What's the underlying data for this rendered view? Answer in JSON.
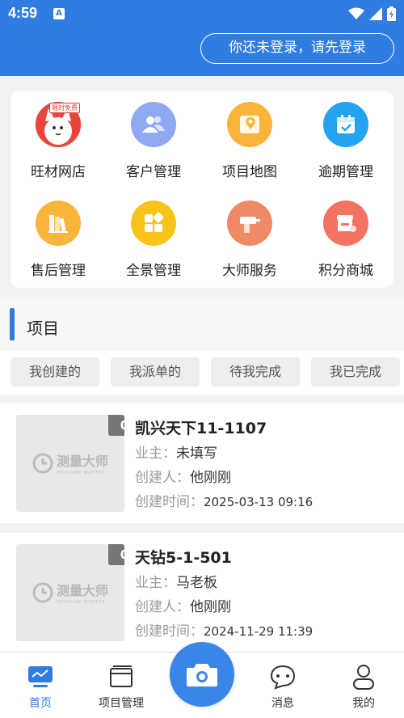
{
  "status": {
    "time": "4:59",
    "app_icon_letter": "A"
  },
  "header": {
    "login_prompt": "你还未登录，请先登录"
  },
  "grid": {
    "items": [
      {
        "label": "旺材网店",
        "icon": "store-mascot-icon",
        "color": "#e8463a",
        "promo_tag": "限时免费"
      },
      {
        "label": "客户管理",
        "icon": "customers-icon",
        "color": "#8fa8f2"
      },
      {
        "label": "项目地图",
        "icon": "map-icon",
        "color": "#f9b43a"
      },
      {
        "label": "逾期管理",
        "icon": "calendar-check-icon",
        "color": "#24a3ee"
      },
      {
        "label": "售后管理",
        "icon": "books-icon",
        "color": "#f9b43a"
      },
      {
        "label": "全景管理",
        "icon": "panorama-grid-icon",
        "color": "#f8c41c"
      },
      {
        "label": "大师服务",
        "icon": "drill-icon",
        "color": "#f08a66"
      },
      {
        "label": "积分商城",
        "icon": "shop-icon",
        "color": "#f27362"
      }
    ]
  },
  "section": {
    "title": "项目"
  },
  "filters": [
    "我创建的",
    "我派单的",
    "待我完成",
    "我已完成"
  ],
  "projects": [
    {
      "count": "0",
      "title": "凯兴天下11-1107",
      "owner_label": "业主：",
      "owner": "未填写",
      "creator_label": "创建人：",
      "creator": "他刚刚",
      "time_label": "创建时间：",
      "time": "2025-03-13 09:16",
      "thumb_text": "测量大师",
      "thumb_sub": "MEASURE MASTER"
    },
    {
      "count": "0",
      "title": "天钻5-1-501",
      "owner_label": "业主：",
      "owner": "马老板",
      "creator_label": "创建人：",
      "creator": "他刚刚",
      "time_label": "创建时间：",
      "time": "2024-11-29 11:39",
      "thumb_text": "测量大师",
      "thumb_sub": "MEASURE MASTER"
    }
  ],
  "tabbar": {
    "home": "首页",
    "projects": "项目管理",
    "messages": "消息",
    "mine": "我的"
  },
  "colors": {
    "primary": "#2f7de1",
    "badge": "#777777"
  }
}
